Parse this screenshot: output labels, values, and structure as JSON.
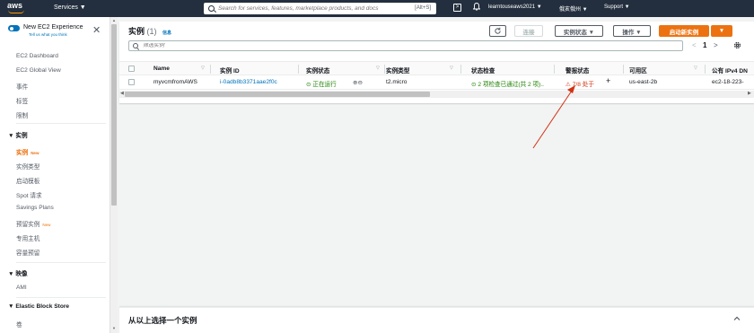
{
  "topnav": {
    "logo_text": "aws",
    "services_label": "Services ▼",
    "search_placeholder": "Search for services, features, marketplace products, and docs",
    "search_shortcut": "[Alt+S]",
    "account_label": "learntouseaws2021 ▼",
    "region_label": "俄亥俄州 ▼",
    "support_label": "Support ▼",
    "icons": [
      "aws-logo",
      "services-caret",
      "search-icon",
      "cloudshell-icon",
      "bell-icon"
    ],
    "brand_color": "#232f3e",
    "accent_color": "#ff9900"
  },
  "sidebar": {
    "new_experience_title": "New EC2 Experience",
    "new_experience_sub": "Tell us what you think",
    "items_top": [
      "EC2 Dashboard",
      "EC2 Global View",
      "事件",
      "标签",
      "限制"
    ],
    "section_instances": "▼ 实例",
    "instances_items": [
      {
        "label": "实例",
        "tag": "New",
        "active": true
      },
      {
        "label": "实例类型",
        "tag": ""
      },
      {
        "label": "启动模板",
        "tag": ""
      },
      {
        "label": "Spot 请求",
        "tag": ""
      },
      {
        "label": "Savings Plans",
        "tag": ""
      },
      {
        "label": "预留实例",
        "tag": "New"
      },
      {
        "label": "专用主机",
        "tag": ""
      },
      {
        "label": "容量预留",
        "tag": ""
      }
    ],
    "section_images": "▼ 映像",
    "images_items": [
      "AMI"
    ],
    "section_ebs": "▼ Elastic Block Store",
    "ebs_items": [
      "卷"
    ],
    "active_color": "#ec7211"
  },
  "instances": {
    "title": "实例",
    "count": "(1)",
    "info_label": "信息",
    "refresh_icon": "refresh-icon",
    "connect_label": "连接",
    "state_button": "实例状态 ▼",
    "actions_button": "操作 ▼",
    "launch_button": "启动新实例",
    "launch_caret": "▼",
    "filter_placeholder": "筛选实例",
    "pager_prev": "<",
    "pager_page": "1",
    "pager_next": ">",
    "columns": [
      "Name",
      "实例 ID",
      "实例状态",
      "实例类型",
      "状态检查",
      "警报状态",
      "可用区",
      "公有 IPv4 DN"
    ],
    "rows": [
      {
        "name": "myvcmfromAWS",
        "instance_id": "i-0adb8b3371aae2f0c",
        "state": "正在运行",
        "state_icons": "⊕⊖",
        "type": "t2.micro",
        "status_check": "2 项检查已通过(共 2 项)..",
        "alarm": "7/8 处于",
        "alarm_add": "+",
        "az": "us-east-2b",
        "public_dns": "ec2-18-223-"
      }
    ]
  },
  "details_panel": {
    "title": "从以上选择一个实例",
    "chevron": "chevron-up-icon"
  }
}
